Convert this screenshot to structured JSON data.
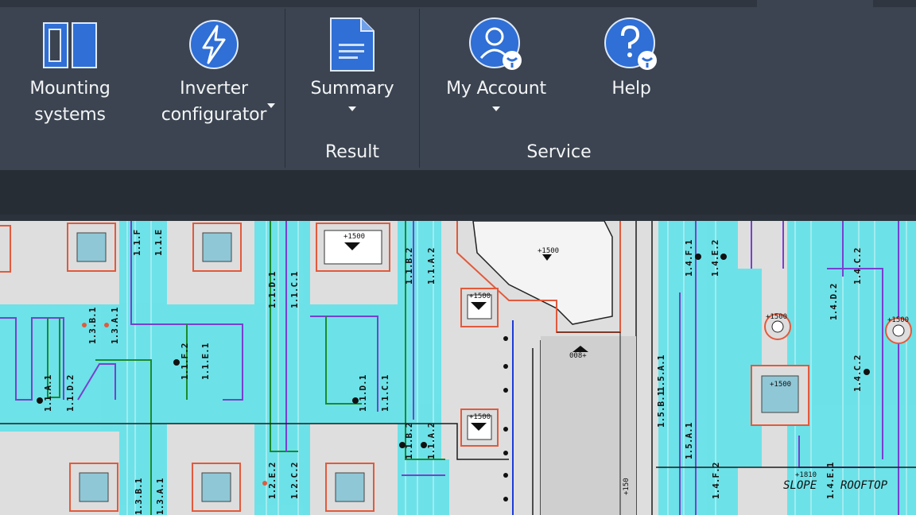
{
  "ribbon": {
    "buttons": [
      {
        "id": "mounting",
        "line1": "Mounting",
        "line2": "systems",
        "dropdown": false
      },
      {
        "id": "inverter",
        "line1": "Inverter",
        "line2": "configurator",
        "dropdown": true
      },
      {
        "id": "summary",
        "line1": "Summary",
        "dropdown": true
      },
      {
        "id": "account",
        "line1": "My Account",
        "dropdown": true
      },
      {
        "id": "help",
        "line1": "Help",
        "dropdown": false
      }
    ],
    "groups": {
      "result": "Result",
      "service": "Service"
    }
  },
  "drawing": {
    "labels": {
      "l1": "1.1.B.2",
      "l2": "1.1.A.2",
      "l3": "1.1.D.1",
      "l4": "1.1.C.1",
      "l5": "1.3.B.1",
      "l6": "1.3.A.1",
      "l7": "1.1.F.2",
      "l8": "1.1.E.1",
      "l9": "1.1.A.1",
      "l10": "1.1.D.2",
      "l11": "1.1.D.1",
      "l12": "1.1.C.1",
      "l13": "1.1.B.2",
      "l14": "1.1.A.2",
      "l15": "1.2.E.2",
      "l16": "1.2.C.2",
      "l17": "1.3.B.1",
      "l18": "1.3.A.1",
      "l19": "1.4.F.1",
      "l20": "1.4.E.2",
      "l21": "1.4.C.2",
      "l22": "1.4.D.2",
      "l23": "1.4.C.2",
      "l24": "1.5.A.1",
      "l25": "1.5.B.1",
      "l26": "1.5.A.1",
      "l27": "1.4.F.2",
      "l28": "1.4.E.1",
      "l29": "1.1.F",
      "l30": "1.1.E",
      "e1": "+1500",
      "e2": "+1500",
      "e3": "+1500",
      "e4": "+1500",
      "e5": "008+",
      "e6": "+1500",
      "e7": "+1500",
      "e8": "+1500",
      "e9": "+1810",
      "e10": "+150",
      "slope": "SLOPE",
      "rooftop": "ROOFTOP"
    }
  }
}
